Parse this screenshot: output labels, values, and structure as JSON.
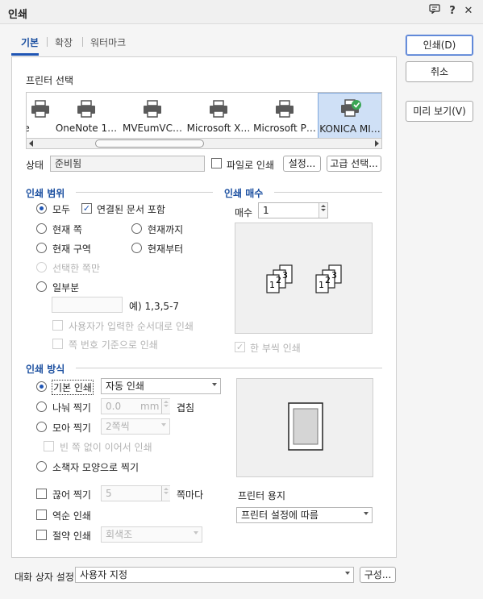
{
  "window": {
    "title": "인쇄"
  },
  "titlebar_icons": [
    {
      "name": "chat-icon",
      "glyph": "▭"
    },
    {
      "name": "help-icon",
      "glyph": "?"
    },
    {
      "name": "close-icon",
      "glyph": "✕"
    }
  ],
  "tabs": [
    {
      "label": "기본"
    },
    {
      "label": "확장"
    },
    {
      "label": "워터마크"
    }
  ],
  "side_buttons": {
    "print": "인쇄(D)",
    "cancel": "취소",
    "preview": "미리 보기(V)"
  },
  "printer_select": {
    "label": "프린터 선택",
    "printers": [
      {
        "name": "ote",
        "status": "none"
      },
      {
        "name": "OneNote 1…",
        "status": "none"
      },
      {
        "name": "MVEumVC…",
        "status": "none"
      },
      {
        "name": "Microsoft X…",
        "status": "none"
      },
      {
        "name": "Microsoft P…",
        "status": "none"
      },
      {
        "name": "KONICA MI…",
        "status": "default-check"
      }
    ]
  },
  "status": {
    "label": "상태",
    "value": "준비됨",
    "print_to_file": "파일로 인쇄",
    "settings_button": "설정...",
    "advanced_button": "고급 선택..."
  },
  "range": {
    "label": "인쇄 범위",
    "all": "모두",
    "include_linked": "연결된 문서 포함",
    "current_page": "현재 쪽",
    "to_current": "현재까지",
    "current_section": "현재 구역",
    "from_current": "현재부터",
    "selected_only": "선택한 쪽만",
    "partial": "일부분",
    "example": "예) 1,3,5-7",
    "user_order": "사용자가 입력한 순서대로 인쇄",
    "page_number_basis": "쪽 번호 기준으로 인쇄"
  },
  "copies": {
    "label": "인쇄 매수",
    "count_label": "매수",
    "count_value": "1",
    "collate": "한 부씩 인쇄",
    "stack_1": [
      "1",
      "2",
      "3"
    ],
    "stack_2": [
      "1",
      "2",
      "3"
    ]
  },
  "method": {
    "label": "인쇄 방식",
    "basic": "기본 인쇄",
    "basic_select": "자동 인쇄",
    "split": "나눠 찍기",
    "split_value": "0.0",
    "split_unit": "mm",
    "overlap": "겹침",
    "gather": "모아 찍기",
    "gather_select": "2쪽씩",
    "no_blank": "빈 쪽 없이 이어서 인쇄",
    "booklet": "소책자 모양으로 찍기",
    "cut": "끊어 찍기",
    "cut_value": "5",
    "cut_unit": "쪽마다",
    "reverse": "역순 인쇄",
    "save_ink": "절약 인쇄",
    "save_ink_select": "회색조",
    "paper_label": "프린터 용지",
    "paper_select": "프린터 설정에 따름"
  },
  "footer": {
    "label": "대화 상자 설정",
    "select": "사용자 지정",
    "config_button": "구성..."
  },
  "colors": {
    "accent": "#1f55b4",
    "selected_bg": "#cfe0f6"
  }
}
